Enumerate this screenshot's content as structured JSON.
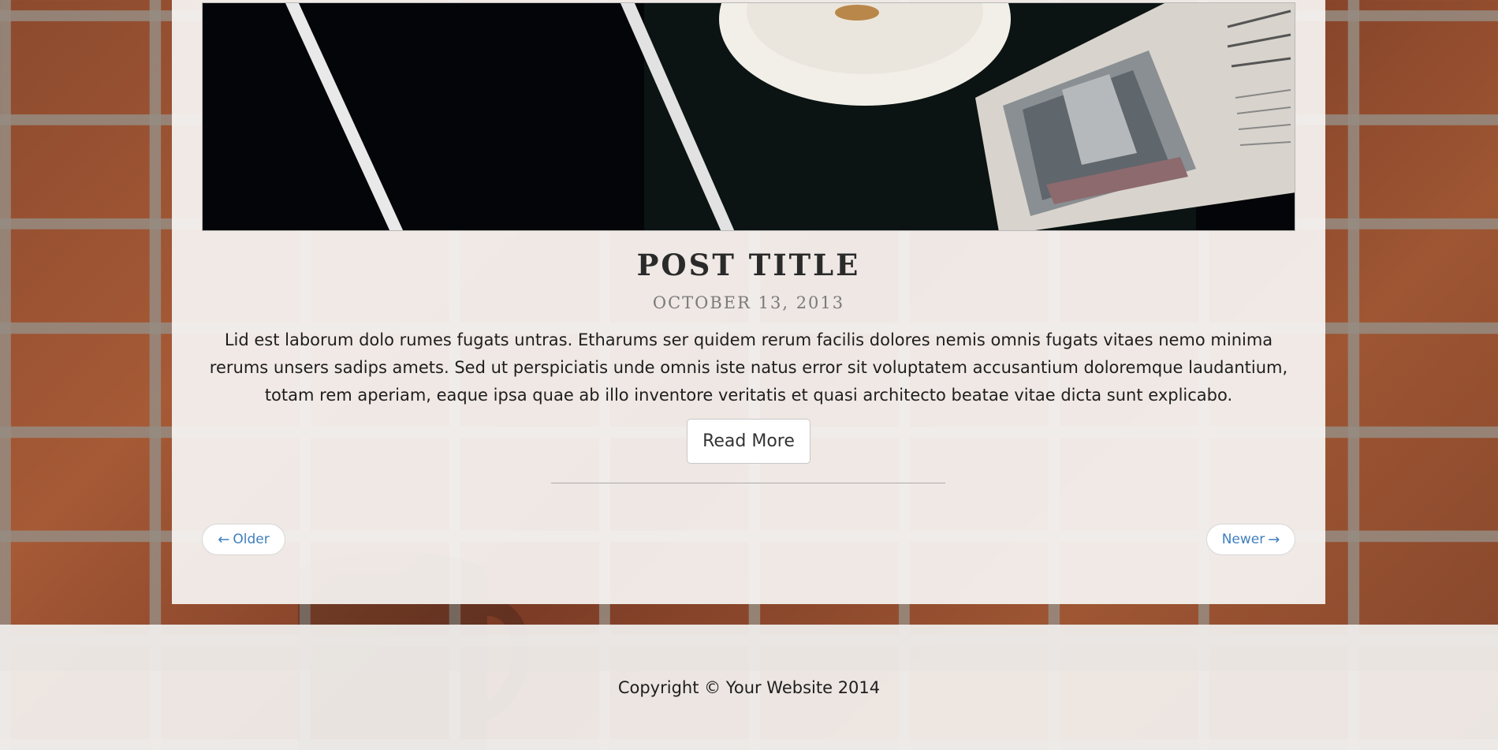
{
  "post": {
    "title": "POST TITLE",
    "date": "OCTOBER 13, 2013",
    "excerpt": "Lid est laborum dolo rumes fugats untras. Etharums ser quidem rerum facilis dolores nemis omnis fugats vitaes nemo minima rerums unsers sadips amets. Sed ut perspiciatis unde omnis iste natus error sit voluptatem accusantium doloremque laudantium, totam rem aperiam, eaque ipsa quae ab illo inventore veritatis et quasi architecto beatae vitae dicta sunt explicabo.",
    "read_more_label": "Read More",
    "hero_image_icon": "photo-icon"
  },
  "pager": {
    "older_label": "Older",
    "older_arrow": "←",
    "newer_label": "Newer",
    "newer_arrow": "→"
  },
  "footer": {
    "copyright": "Copyright © Your Website 2014"
  },
  "colors": {
    "link": "#3f7fbf",
    "text": "#1e1e1e",
    "date": "#7a7a7a",
    "panel": "#f5f2f0",
    "brick": "#8c4a2e"
  }
}
